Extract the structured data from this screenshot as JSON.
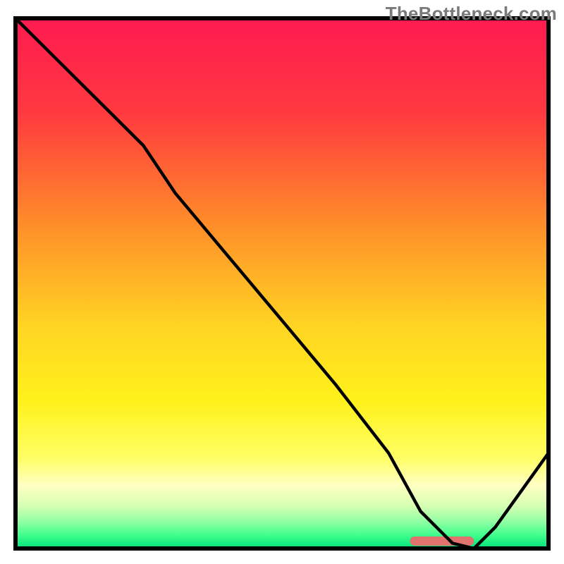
{
  "watermark": "TheBottleneck.com",
  "chart_data": {
    "type": "line",
    "title": "",
    "xlabel": "",
    "ylabel": "",
    "xlim": [
      0,
      100
    ],
    "ylim": [
      0,
      100
    ],
    "grid": false,
    "background_gradient": {
      "stops": [
        {
          "offset": 0.0,
          "color": "#ff1a50"
        },
        {
          "offset": 0.18,
          "color": "#ff3a3f"
        },
        {
          "offset": 0.38,
          "color": "#ff8a2a"
        },
        {
          "offset": 0.58,
          "color": "#ffd423"
        },
        {
          "offset": 0.72,
          "color": "#fff11a"
        },
        {
          "offset": 0.83,
          "color": "#ffff66"
        },
        {
          "offset": 0.88,
          "color": "#ffffc2"
        },
        {
          "offset": 0.92,
          "color": "#d6ffb3"
        },
        {
          "offset": 0.95,
          "color": "#8fffa3"
        },
        {
          "offset": 0.975,
          "color": "#3fff8c"
        },
        {
          "offset": 1.0,
          "color": "#00e07a"
        }
      ]
    },
    "bottom_marker": {
      "x_start": 74,
      "x_end": 86,
      "color": "#e0736d"
    },
    "series": [
      {
        "name": "curve",
        "x": [
          0,
          8,
          18,
          24,
          30,
          40,
          50,
          60,
          70,
          76,
          82,
          86,
          90,
          95,
          100
        ],
        "y": [
          100,
          92,
          82,
          76,
          67,
          55,
          43,
          31,
          18,
          7,
          1,
          0,
          4,
          11,
          18
        ]
      }
    ]
  }
}
